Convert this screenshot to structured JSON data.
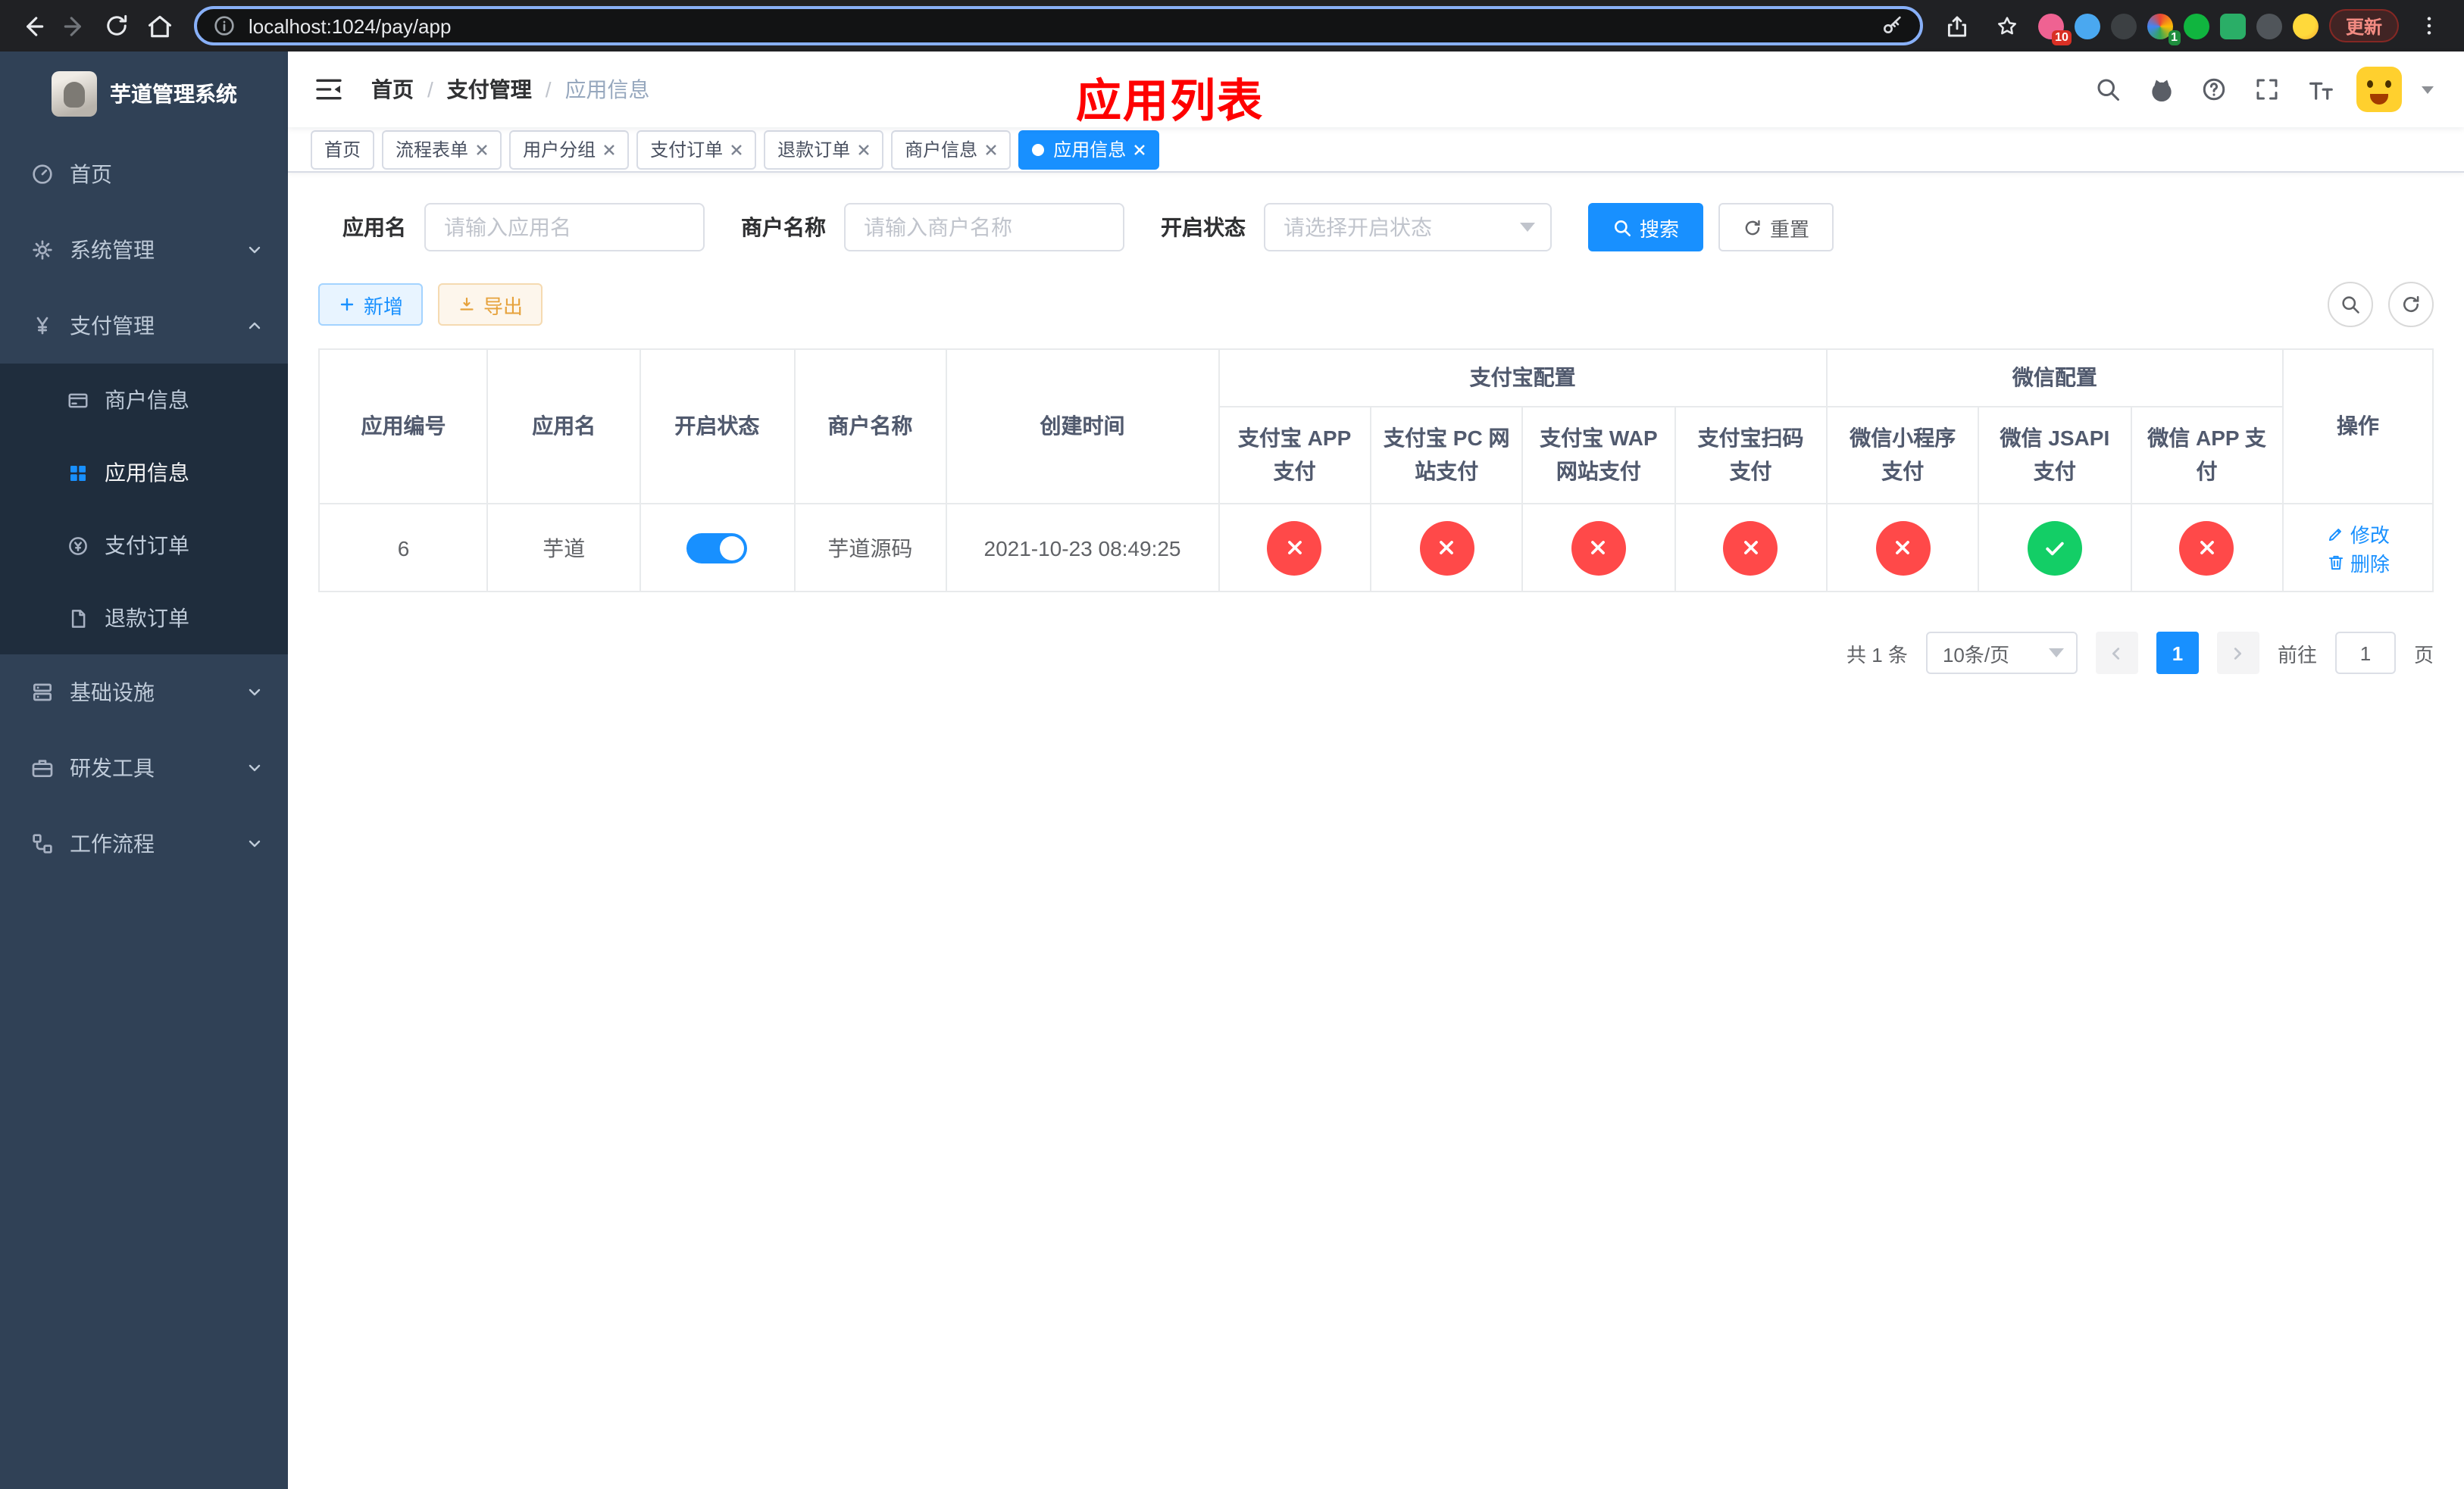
{
  "colors": {
    "accent": "#1890ff",
    "danger": "#ff4949",
    "success": "#13ce66",
    "sidebar_bg": "#304156",
    "submenu_bg": "#1f2d3d",
    "annotation": "#fe0000"
  },
  "browser": {
    "url": "localhost:1024/pay/app",
    "update_label": "更新",
    "extension_badges": {
      "first": "10",
      "second": "1"
    }
  },
  "sidebar": {
    "title": "芋道管理系统",
    "items": [
      {
        "label": "首页"
      },
      {
        "label": "系统管理"
      },
      {
        "label": "支付管理"
      },
      {
        "label": "商户信息"
      },
      {
        "label": "应用信息"
      },
      {
        "label": "支付订单"
      },
      {
        "label": "退款订单"
      },
      {
        "label": "基础设施"
      },
      {
        "label": "研发工具"
      },
      {
        "label": "工作流程"
      }
    ]
  },
  "navbar": {
    "breadcrumb": [
      {
        "label": "首页"
      },
      {
        "label": "支付管理"
      },
      {
        "label": "应用信息"
      }
    ],
    "separator": "/",
    "annotation": "应用列表"
  },
  "tabs": [
    {
      "label": "首页"
    },
    {
      "label": "流程表单"
    },
    {
      "label": "用户分组"
    },
    {
      "label": "支付订单"
    },
    {
      "label": "退款订单"
    },
    {
      "label": "商户信息"
    },
    {
      "label": "应用信息"
    }
  ],
  "filters": {
    "app_name": {
      "label": "应用名",
      "placeholder": "请输入应用名"
    },
    "merchant": {
      "label": "商户名称",
      "placeholder": "请输入商户名称"
    },
    "status": {
      "label": "开启状态",
      "placeholder": "请选择开启状态"
    },
    "search_label": "搜索",
    "reset_label": "重置"
  },
  "toolbar": {
    "add_label": "新增",
    "export_label": "导出"
  },
  "table": {
    "groups": {
      "alipay": "支付宝配置",
      "wechat": "微信配置"
    },
    "columns": [
      "应用编号",
      "应用名",
      "开启状态",
      "商户名称",
      "创建时间",
      "支付宝 APP 支付",
      "支付宝 PC 网站支付",
      "支付宝 WAP 网站支付",
      "支付宝扫码支付",
      "微信小程序支付",
      "微信 JSAPI 支付",
      "微信 APP 支付",
      "操作"
    ],
    "rows": [
      {
        "id": "6",
        "name": "芋道",
        "enabled": true,
        "merchant": "芋道源码",
        "created": "2021-10-23 08:49:25",
        "configs": [
          false,
          false,
          false,
          false,
          false,
          true,
          false
        ],
        "edit_label": "修改",
        "delete_label": "删除"
      }
    ]
  },
  "pagination": {
    "total": "共 1 条",
    "page_size": "10条/页",
    "current": "1",
    "goto_prefix": "前往",
    "goto_value": "1",
    "goto_suffix": "页"
  }
}
